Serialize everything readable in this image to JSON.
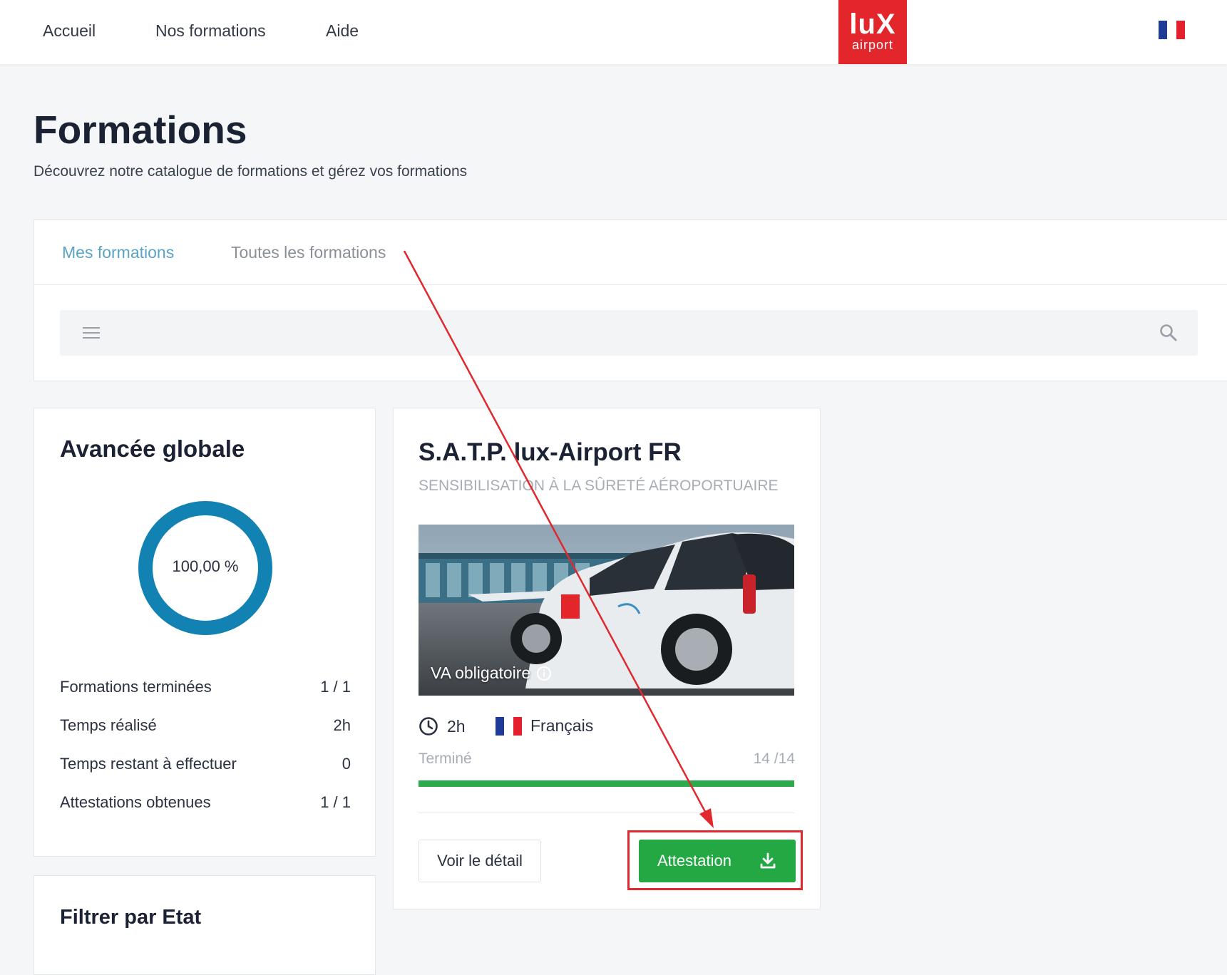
{
  "nav": {
    "links": [
      "Accueil",
      "Nos formations",
      "Aide"
    ],
    "logo": {
      "line1": "luX",
      "line2": "airport"
    },
    "language_flag": "french-flag-icon"
  },
  "page": {
    "title": "Formations",
    "subtitle": "Découvrez notre catalogue de formations et gérez vos formations"
  },
  "tabs": {
    "active": "Mes formations",
    "inactive": "Toutes les formations"
  },
  "search": {
    "placeholder": "",
    "filter_icon": "menu-icon",
    "search_icon": "search-icon"
  },
  "progress_summary": {
    "title": "Avancée globale",
    "percent_label": "100,00 %",
    "percent_value": 100,
    "stats": [
      {
        "label": "Formations terminées",
        "value": "1 / 1"
      },
      {
        "label": "Temps réalisé",
        "value": "2h"
      },
      {
        "label": "Temps restant à effectuer",
        "value": "0"
      },
      {
        "label": "Attestations obtenues",
        "value": "1 / 1"
      }
    ],
    "ring_color": "#1282b3"
  },
  "filter_card": {
    "title": "Filtrer par Etat"
  },
  "course": {
    "title": "S.A.T.P. lux-Airport FR",
    "subtitle": "SENSIBILISATION À LA SÛRETÉ AÉROPORTUAIRE",
    "image_label": "VA obligatoire",
    "duration": "2h",
    "language": "Français",
    "status": "Terminé",
    "count": "14 /14",
    "progress_fraction": 1.0,
    "detail_button": "Voir le détail",
    "attestation_button": "Attestation",
    "accent_color": "#23a844"
  },
  "annotation": {
    "color": "#e0282e"
  }
}
